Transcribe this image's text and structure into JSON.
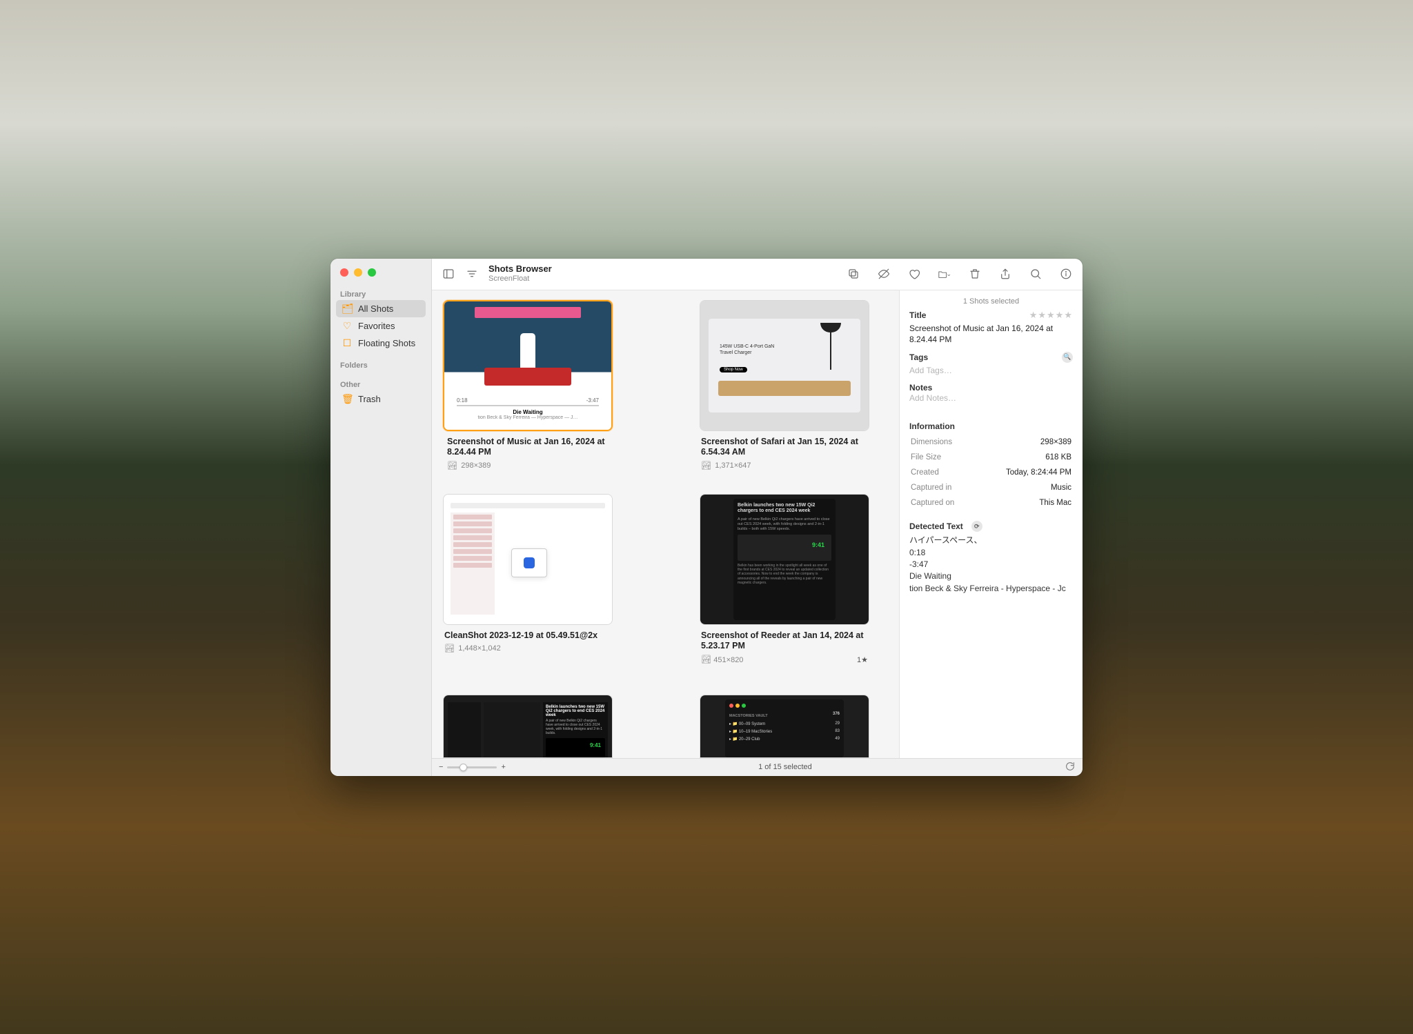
{
  "header": {
    "title": "Shots Browser",
    "subtitle": "ScreenFloat"
  },
  "sidebar": {
    "library_label": "Library",
    "folders_label": "Folders",
    "other_label": "Other",
    "items": [
      {
        "label": "All Shots"
      },
      {
        "label": "Favorites"
      },
      {
        "label": "Floating Shots"
      }
    ],
    "trash_label": "Trash"
  },
  "footer": {
    "status": "1 of 15 selected",
    "zoom_minus": "−",
    "zoom_plus": "+"
  },
  "grid": {
    "items": [
      {
        "title": "Screenshot of Music at Jan 16, 2024 at 8.24.44 PM",
        "dim": "298×389",
        "thumb": {
          "time_l": "0:18",
          "time_r": "-3:47",
          "song": "Die Waiting",
          "artist": "tion   Beck & Sky Ferreira — Hyperspace — J…"
        }
      },
      {
        "title": "Screenshot of Safari at Jan 15, 2024 at 6.54.34 AM",
        "dim": "1,371×647",
        "thumb": {
          "txt": "145W USB-C 4-Port GaN Travel Charger",
          "btn": "Shop Now"
        }
      },
      {
        "title": "CleanShot 2023-12-19 at 05.49.51@2x",
        "dim": "1,448×1,042"
      },
      {
        "title": "Screenshot of Reeder at Jan 14, 2024 at 5.23.17 PM",
        "dim": "451×820",
        "star": "1★",
        "thumb": {
          "hd": "Belkin launches two new 15W Qi2 chargers to end CES 2024 week",
          "bd": "A pair of new Belkin Qi2 chargers have arrived to close out CES 2024 week, with folding designs and 2-in-1 builds – both with 15W speeds.",
          "ft": "Belkin has been working in the spotlight all week as one of the first brands at CES 2024 to reveal an updated collection of accessories. Now to end the week the company is announcing all of the reveals by launching a pair of new magnetic chargers."
        }
      }
    ],
    "cut": [
      {
        "thumb": {
          "h5": "Belkin launches two new 15W Qi2 chargers to end CES 2024 week",
          "b5": "A pair of new Belkin Qi2 chargers have arrived to close out CES 2024 week, with folding designs and 2-in-1 builds."
        }
      },
      {
        "thumb": {
          "cat": "MACSTORIES VAULT",
          "rows": [
            [
              "00–09 System",
              "29"
            ],
            [
              "10–19 MacStories",
              "83"
            ],
            [
              "20–29 Club",
              "49"
            ]
          ],
          "count": "376"
        }
      }
    ]
  },
  "inspector": {
    "selected": "1 Shots selected",
    "title_label": "Title",
    "title_value": "Screenshot of Music at Jan 16, 2024 at 8.24.44 PM",
    "tags_label": "Tags",
    "tags_placeholder": "Add Tags…",
    "notes_label": "Notes",
    "notes_placeholder": "Add Notes…",
    "info_label": "Information",
    "info": {
      "dimensions_k": "Dimensions",
      "dimensions_v": "298×389",
      "size_k": "File Size",
      "size_v": "618 KB",
      "created_k": "Created",
      "created_v": "Today, 8:24:44 PM",
      "capturedin_k": "Captured in",
      "capturedin_v": "Music",
      "capturedon_k": "Captured on",
      "capturedon_v": "This Mac"
    },
    "detected_label": "Detected Text",
    "detected_text": "ハイパースペース、\n0:18\n-3:47\nDie Waiting\ntion Beck & Sky Ferreira - Hyperspace - Jc"
  }
}
